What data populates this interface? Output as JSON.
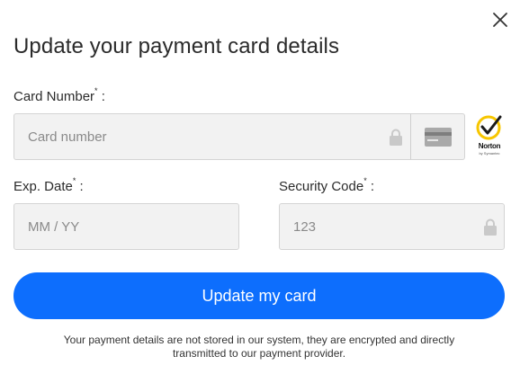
{
  "modal": {
    "title": "Update your payment card details",
    "close_icon": "close-icon"
  },
  "form": {
    "card_number": {
      "label": "Card Number",
      "required_mark": "*",
      "suffix": " :",
      "placeholder": "Card number",
      "value": ""
    },
    "exp_date": {
      "label": "Exp. Date",
      "required_mark": "*",
      "suffix": " :",
      "placeholder": "MM / YY",
      "value": ""
    },
    "security_code": {
      "label": "Security Code",
      "required_mark": "*",
      "suffix": " :",
      "placeholder": "123",
      "value": ""
    },
    "card_type_icon": "credit-card-icon",
    "lock_icon": "lock-icon"
  },
  "norton": {
    "brand": "Norton",
    "sub": "by Symantec"
  },
  "submit": {
    "label": "Update my card"
  },
  "disclaimer": {
    "text": "Your payment details are not stored in our system, they are encrypted and directly transmitted to our payment provider."
  },
  "colors": {
    "accent": "#0d6efd",
    "field_bg": "#f2f2f2",
    "field_border": "#d4d4d4",
    "norton_yellow": "#f7c600"
  }
}
